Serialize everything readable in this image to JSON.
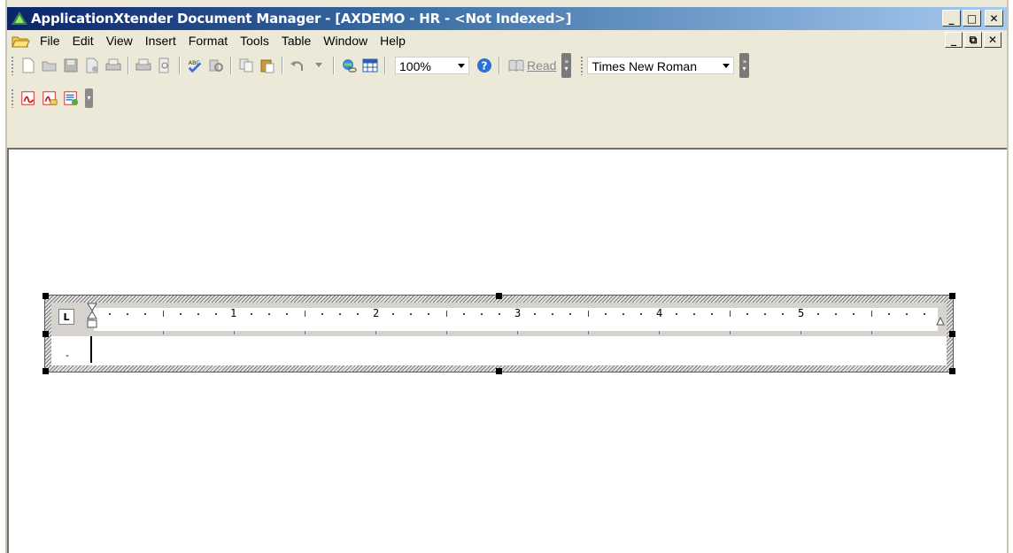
{
  "window": {
    "title": "ApplicationXtender Document Manager - [AXDEMO - HR - <Not Indexed>]",
    "controls": {
      "minimize": "_",
      "maximize": "□",
      "close": "✕"
    }
  },
  "menubar": {
    "items": [
      "File",
      "Edit",
      "View",
      "Insert",
      "Format",
      "Tools",
      "Table",
      "Window",
      "Help"
    ],
    "mdi_controls": {
      "minimize": "_",
      "restore": "⧉",
      "close": "✕"
    }
  },
  "toolbar": {
    "zoom": "100%",
    "read_label": "Read",
    "font": "Times New Roman"
  },
  "ruler": {
    "numbers": [
      "1",
      "2",
      "3",
      "4",
      "5"
    ],
    "tab_marker": "L"
  },
  "document": {
    "line_marker": "-"
  },
  "colors": {
    "title_gradient_start": "#0a246a",
    "title_gradient_end": "#a6caf0",
    "chrome": "#ece9d8"
  }
}
